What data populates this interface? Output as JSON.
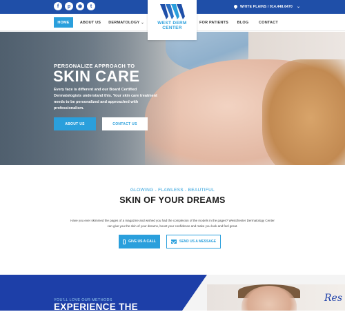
{
  "topbar": {
    "social": [
      {
        "name": "facebook-icon",
        "glyph": "f"
      },
      {
        "name": "pinterest-icon",
        "glyph": "p"
      },
      {
        "name": "instagram-icon",
        "glyph": "◉"
      },
      {
        "name": "twitter-icon",
        "glyph": "t"
      }
    ],
    "location": "WHITE PLAINS / 914.448.6470",
    "location_chevron": "⌄"
  },
  "nav": {
    "items": [
      {
        "label": "HOME"
      },
      {
        "label": "ABOUT US"
      },
      {
        "label": "DERMATOLOGY"
      },
      {
        "label": "FOR PATIENTS"
      },
      {
        "label": "BLOG"
      },
      {
        "label": "CONTACT"
      }
    ],
    "caret": "⌄"
  },
  "logo": {
    "line1": "WEST DERM",
    "line2": "CENTER"
  },
  "hero": {
    "kicker": "PERSONALIZE APPROACH TO",
    "title": "SKIN CARE",
    "body": "Every face is different and our Board Certified Dermatologists understand this. Your skin care treatment needs to be personalized and approached with professionalism.",
    "btn_about": "ABOUT US",
    "btn_contact": "CONTACT US"
  },
  "mid": {
    "kicker": "GLOWING - FLAWLESS - BEAUTIFUL",
    "title": "SKIN OF YOUR DREAMS",
    "body": "Have you ever skimmed the pages of a magazine and wished you had the complexion of the models in the pages? Westchester Dermatology Center can give you the skin of your dreams, boost your confidence and make you look and feel great.",
    "btn_call": "GIVE US A CALL",
    "btn_message": "SEND US A MESSAGE"
  },
  "bottom": {
    "kicker": "YOU'LL LOVE OUR METHODS",
    "title": "EXPERIENCE THE",
    "script": "Res"
  },
  "colors": {
    "brand_blue": "#1f4fa8",
    "accent_blue": "#2a9fdc"
  }
}
